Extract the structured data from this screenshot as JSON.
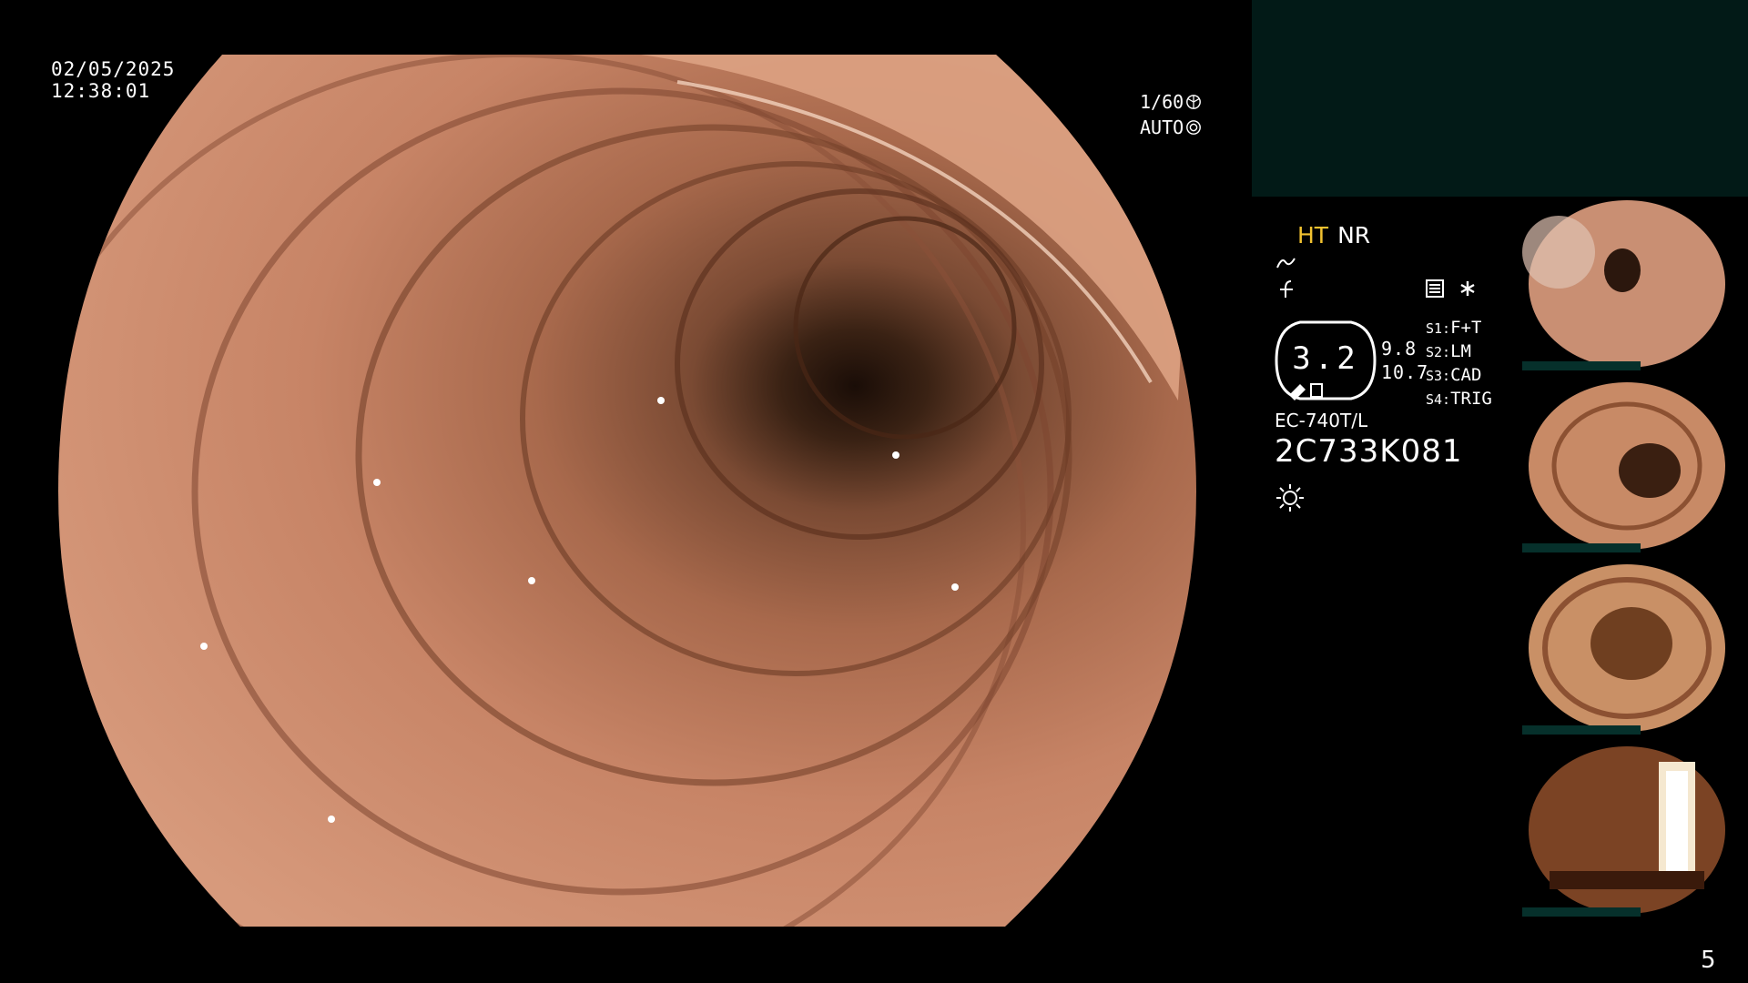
{
  "overlay": {
    "date": "02/05/2025",
    "time": "12:38:01",
    "shutter": "1/60",
    "exposure": "AUTO"
  },
  "settings": {
    "mode_ht": "HT",
    "mode_nr": "NR",
    "gauge_value": "3.2",
    "side_value_1": "9.8",
    "side_value_2": "10.7",
    "s_items": [
      {
        "key": "S1:",
        "value": "F+T"
      },
      {
        "key": "S2:",
        "value": "LM"
      },
      {
        "key": "S3:",
        "value": "CAD"
      },
      {
        "key": "S4:",
        "value": "TRIG"
      }
    ],
    "model": "EC-740T/L",
    "serial": "2C733K081"
  },
  "icons": [
    "wave-icon",
    "f-curve-icon",
    "document-icon",
    "asterisk-icon",
    "sun-icon",
    "shutter-icon",
    "aperture-icon"
  ],
  "colors": {
    "panel_bg": "#021a17",
    "mode_ht": "#f2c230",
    "tissue": "#c78466"
  },
  "page_number": "5"
}
